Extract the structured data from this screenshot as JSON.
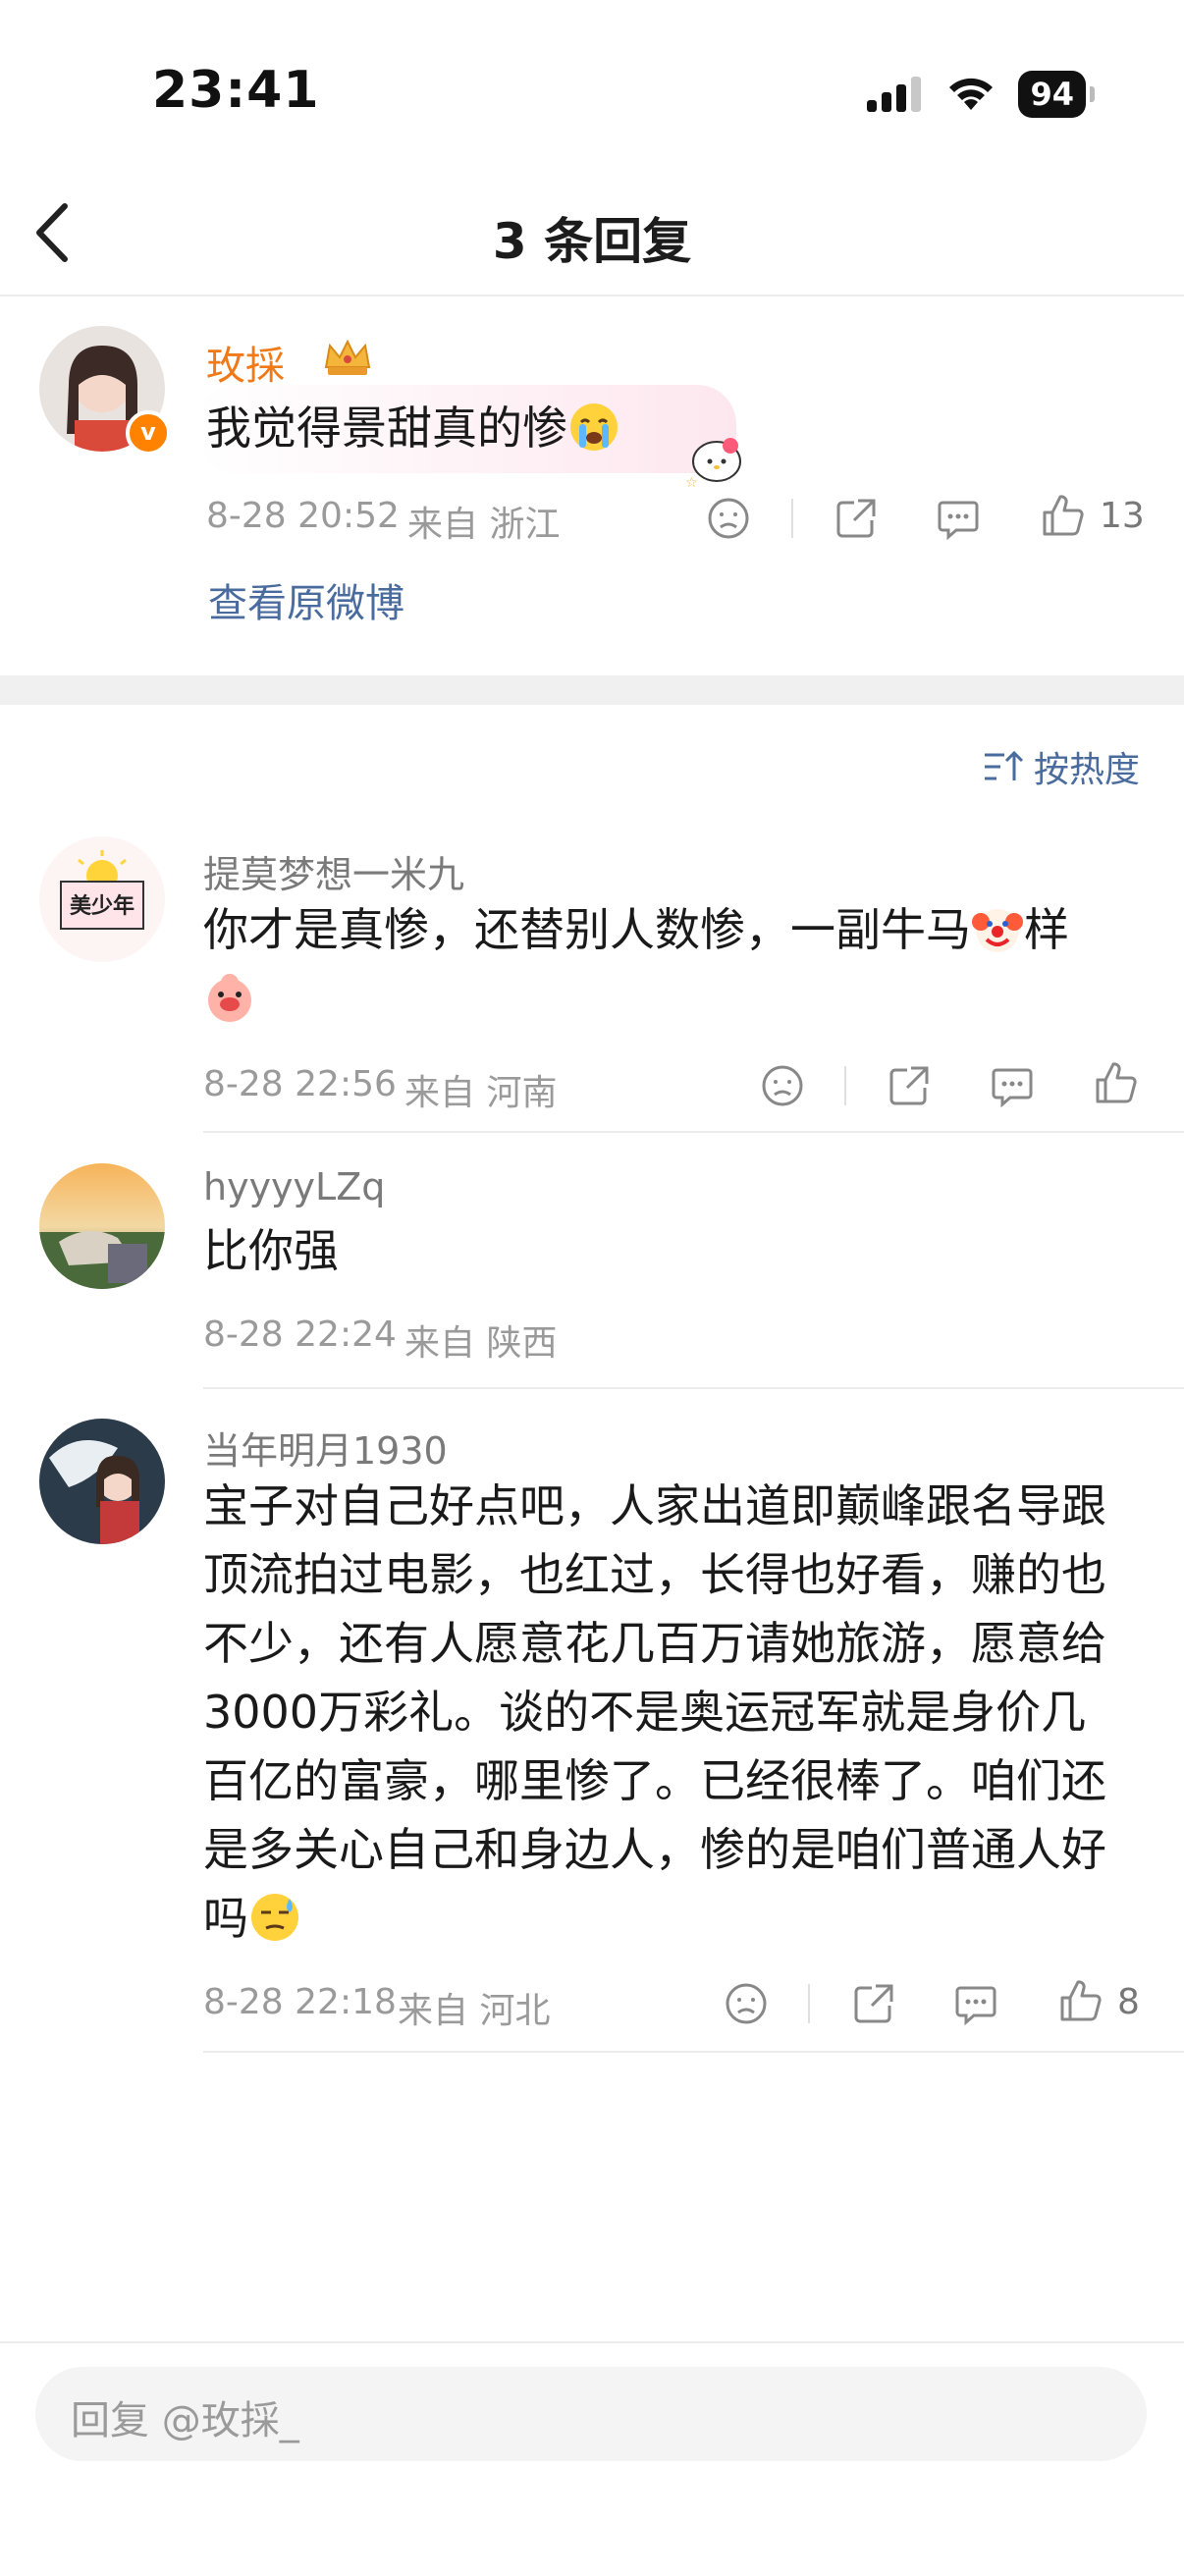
{
  "status": {
    "time": "23:41",
    "battery": "94"
  },
  "nav": {
    "title": "3 条回复"
  },
  "original": {
    "name": "玫採_",
    "text": "我觉得景甜真的惨",
    "date": "8-28 20:52",
    "location": "来自 浙江",
    "likes": "13",
    "view_original": "查看原微博"
  },
  "sort": {
    "label": "按热度"
  },
  "replies": [
    {
      "name": "提莫梦想一米九",
      "avatar_text": "美少年",
      "line1": "你才是真惨，还替别人数惨，一副牛马",
      "line1_tail": "样",
      "date": "8-28 22:56",
      "location": "来自 河南",
      "likes": ""
    },
    {
      "name": "hyyyyLZq",
      "text": "比你强",
      "date": "8-28 22:24",
      "location": "来自 陕西"
    },
    {
      "name": "当年明月1930",
      "lines": [
        "宝子对自己好点吧，人家出道即巅峰跟名导跟",
        "顶流拍过电影，也红过，长得也好看，赚的也",
        "不少，还有人愿意花几百万请她旅游，愿意给",
        "3000万彩礼。谈的不是奥运冠军就是身价几",
        "百亿的富豪，哪里惨了。已经很棒了。咱们还",
        "是多关心自己和身边人，惨的是咱们普通人好",
        "吗"
      ],
      "date": "8-28 22:18",
      "location": "来自 河北",
      "likes": "8"
    }
  ],
  "input": {
    "placeholder": "回复 @玫採_"
  }
}
